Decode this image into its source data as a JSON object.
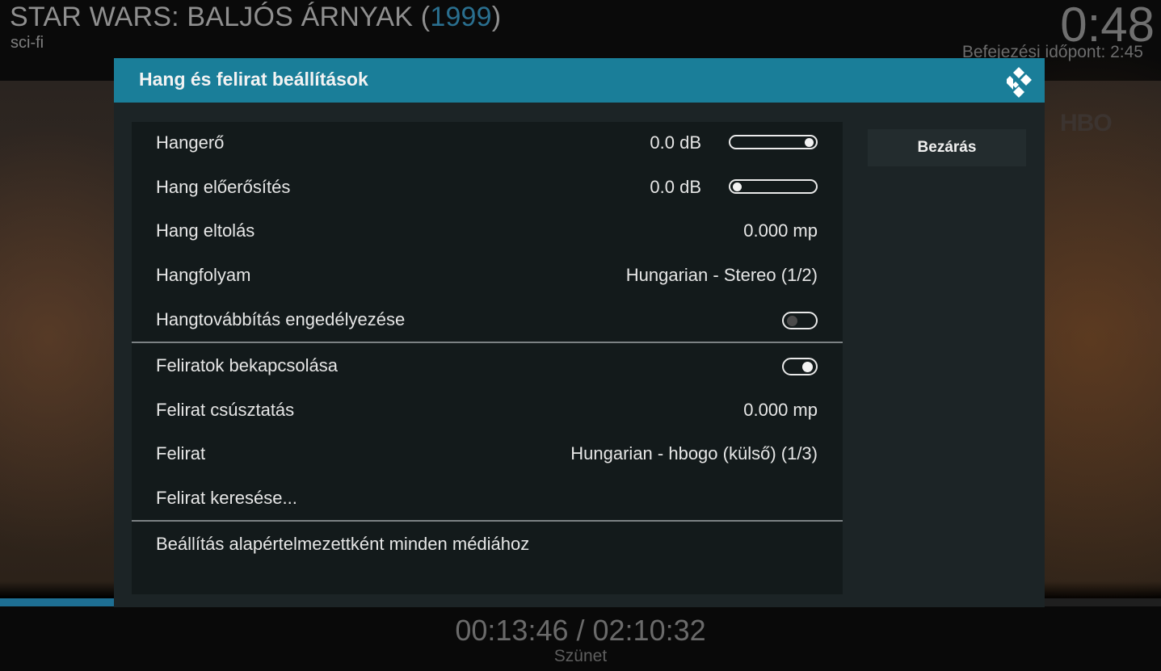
{
  "player": {
    "title_main": "STAR WARS: BALJÓS ÁRNYAK (",
    "title_year": "1999",
    "title_close": ")",
    "genre": "sci-fi",
    "clock": "0:48",
    "end_time": "Befejezési időpont: 2:45",
    "channel_watermark": "HBO",
    "time_readout": "00:13:46 / 02:10:32",
    "state": "Szünet",
    "progress_fraction": 0.106
  },
  "dialog": {
    "title": "Hang és felirat beállítások",
    "close_button": "Bezárás",
    "rows": [
      {
        "label": "Hangerő",
        "value": "0.0 dB",
        "control": "slider",
        "slider_fraction": 1.0
      },
      {
        "label": "Hang előerősítés",
        "value": "0.0 dB",
        "control": "slider",
        "slider_fraction": 0.0
      },
      {
        "label": "Hang eltolás",
        "value": "0.000 mp"
      },
      {
        "label": "Hangfolyam",
        "value": "Hungarian - Stereo (1/2)"
      },
      {
        "label": "Hangtovábbítás engedélyezése",
        "control": "toggle",
        "on": false
      },
      {
        "label": "Feliratok bekapcsolása",
        "control": "toggle",
        "on": true
      },
      {
        "label": "Felirat csúsztatás",
        "value": "0.000 mp"
      },
      {
        "label": "Felirat",
        "value": "Hungarian - hbogo (külső) (1/3)"
      },
      {
        "label": "Felirat keresése..."
      },
      {
        "label": "Beállítás alapértelmezettként minden médiához"
      }
    ]
  },
  "colors": {
    "accent": "#1a7e99",
    "dialog_bg": "#1c2426",
    "list_bg": "#131a1b"
  }
}
